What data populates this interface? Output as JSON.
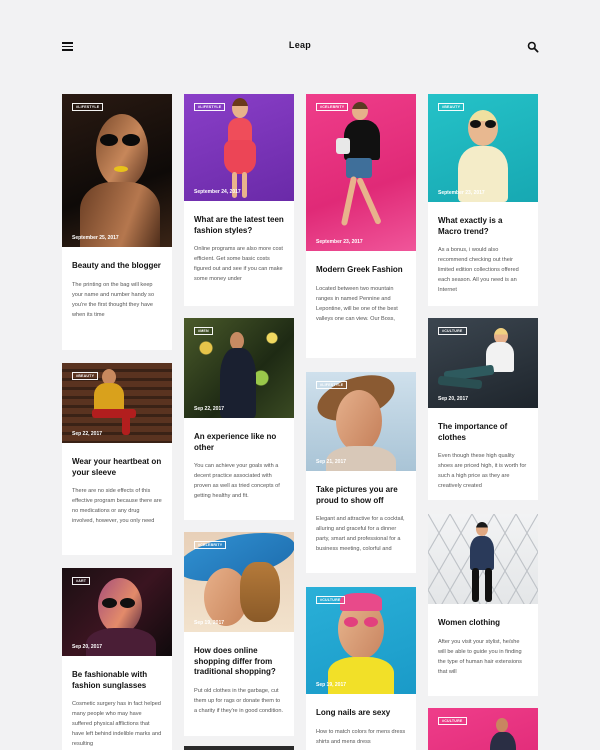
{
  "header": {
    "title": "Leap",
    "menu_icon": "hamburger-menu-icon",
    "search_icon": "search-icon"
  },
  "cards": [
    {
      "tag": "#LIFESTYLE",
      "date": "September 25, 2017",
      "title": "Beauty and the blogger",
      "excerpt": "The printing on the bag will keep your name and number handy so you're the first thought they have when its time"
    },
    {
      "tag": "#BEAUTY",
      "date": "Sep 22, 2017",
      "title": "Wear your heartbeat on your sleeve",
      "excerpt": "There are no side effects of this effective program because there are no medications or any drug involved, however, you only need"
    },
    {
      "tag": "#ART",
      "date": "Sep 20, 2017",
      "title": "Be fashionable with fashion sunglasses",
      "excerpt": "Cosmetic surgery has in fact helped many people who may have suffered physical afflictions that have left behind indelible marks and resulting"
    },
    {
      "tag": "#LIFESTYLE",
      "date": "September 24, 2017",
      "title": "What are the latest teen fashion styles?",
      "excerpt": "Online programs are also more cost efficient. Get some basic costs figured out and see if you can make some money under"
    },
    {
      "tag": "#MEN",
      "date": "Sep 22, 2017",
      "title": "An experience like no other",
      "excerpt": "You can achieve your goals with a decent practice associated with proven as well as tried concepts of getting healthy and fit."
    },
    {
      "tag": "#CELEBRITY",
      "date": "Sep 19, 2017",
      "title": "How does online shopping differ from traditional shopping?",
      "excerpt": "Put old clothes in the garbage, cut them up for rags or donate them to a charity if they're in good condition."
    },
    {
      "tag": "#CELEBRITY",
      "date": "September 23, 2017",
      "title": "Modern Greek Fashion",
      "excerpt": "Located between two mountain ranges in named Pennine and Lepontine, will be one of the best valleys one can view. Our Boss,"
    },
    {
      "tag": "#LIFESTYLE",
      "date": "Sep 21, 2017",
      "title": "Take pictures you are proud to show off",
      "excerpt": "Elegant and attractive for a cocktail, alluring and graceful for a dinner party, smart and professional for a business meeting, colorful and"
    },
    {
      "tag": "#CULTURE",
      "date": "Sep 19, 2017",
      "title": "Long nails are sexy",
      "excerpt": "How to match colors for mens dress shirts and mens dress"
    },
    {
      "tag": "#BEAUTY",
      "date": "September 23, 2017",
      "title": "What exactly is a Macro trend?",
      "excerpt": "As a bonus, i would also recommend checking out their limited edition collections offered each season. All you need is an Internet"
    },
    {
      "tag": "#CULTURE",
      "date": "Sep 20, 2017",
      "title": "The importance of clothes",
      "excerpt": "Even though these high quality shoes are priced high, it is worth for such a high price as they are creatively created"
    },
    {
      "tag": "",
      "date": "",
      "title": "Women clothing",
      "excerpt": "After you visit your stylist, he/she will be able to guide you in finding the type of human hair extensions that will"
    },
    {
      "tag": "#CULTURE",
      "date": "",
      "title": "",
      "excerpt": ""
    }
  ]
}
